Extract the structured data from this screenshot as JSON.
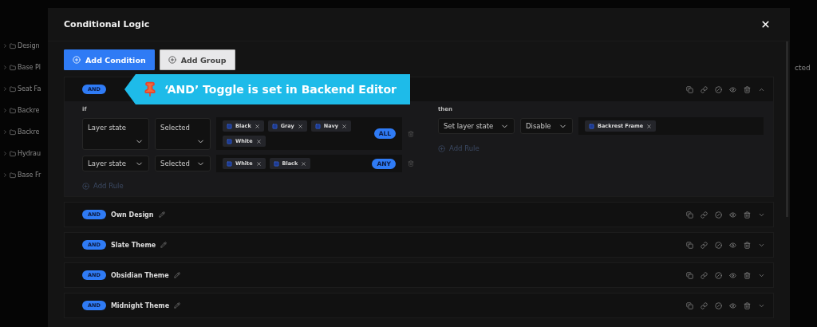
{
  "background": {
    "sidebar_items": [
      "Design",
      "Base Pl",
      "Seat Fa",
      "Backre",
      "Backre",
      "Hydrau",
      "Base Fr"
    ],
    "right_fragment": "cted"
  },
  "dialog": {
    "title": "Conditional Logic",
    "buttons": [
      {
        "label": "Add Condition",
        "kind": "primary"
      },
      {
        "label": "Add Group",
        "kind": "secondary"
      }
    ],
    "callout": "‘AND’ Toggle is set in Backend Editor",
    "groups": [
      {
        "operator": "AND",
        "expanded": true,
        "if_label": "if",
        "then_label": "then",
        "if_add_rule": "Add Rule",
        "then_add_rule": "Add Rule",
        "conditions": [
          {
            "field": "Layer state",
            "operator": "Selected",
            "values": [
              "Black",
              "Gray",
              "Navy",
              "White"
            ],
            "match": "ALL"
          },
          {
            "field": "Layer state",
            "operator": "Selected",
            "values": [
              "White",
              "Black"
            ],
            "match": "ANY"
          }
        ],
        "actions": [
          {
            "field": "Set layer state",
            "operator": "Disable",
            "values": [
              "Backrest Frame"
            ]
          }
        ]
      },
      {
        "operator": "AND",
        "name": "Own Design",
        "expanded": false
      },
      {
        "operator": "AND",
        "name": "Slate Theme",
        "expanded": false
      },
      {
        "operator": "AND",
        "name": "Obsidian Theme",
        "expanded": false
      },
      {
        "operator": "AND",
        "name": "Midnight Theme",
        "expanded": false
      }
    ]
  }
}
